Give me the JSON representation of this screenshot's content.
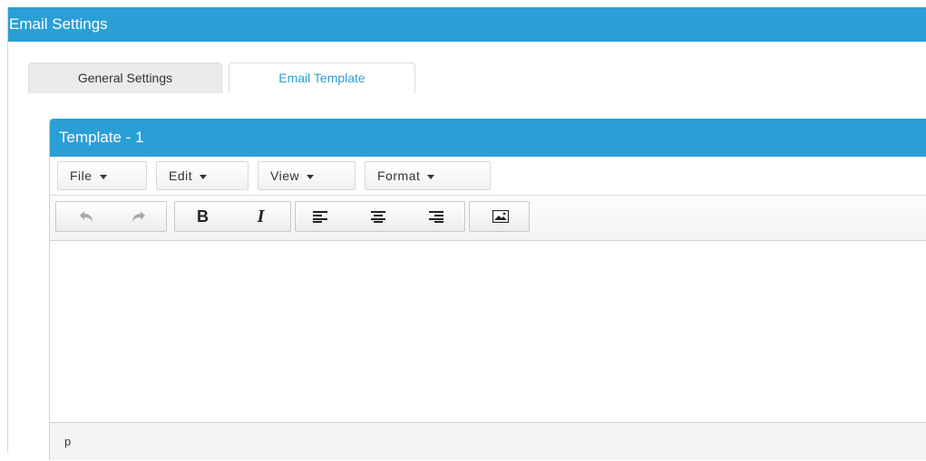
{
  "window": {
    "title": "Email Settings"
  },
  "tabs": [
    {
      "label": "General Settings",
      "active": false
    },
    {
      "label": "Email Template",
      "active": true
    }
  ],
  "template_panel": {
    "title": "Template - 1",
    "menus": [
      {
        "label": "File"
      },
      {
        "label": "Edit"
      },
      {
        "label": "View"
      },
      {
        "label": "Format"
      }
    ],
    "toolbar": [
      {
        "icon": "undo-icon"
      },
      {
        "icon": "redo-icon"
      },
      {
        "icon": "bold-icon",
        "glyph": "B"
      },
      {
        "icon": "italic-icon",
        "glyph": "I"
      },
      {
        "icon": "align-left-icon"
      },
      {
        "icon": "align-center-icon"
      },
      {
        "icon": "align-right-icon"
      },
      {
        "icon": "image-icon"
      }
    ],
    "editor_content": "",
    "status_path": "p"
  },
  "colors": {
    "accent": "#2a9fd6",
    "tab_inactive_bg": "#ebebeb"
  }
}
